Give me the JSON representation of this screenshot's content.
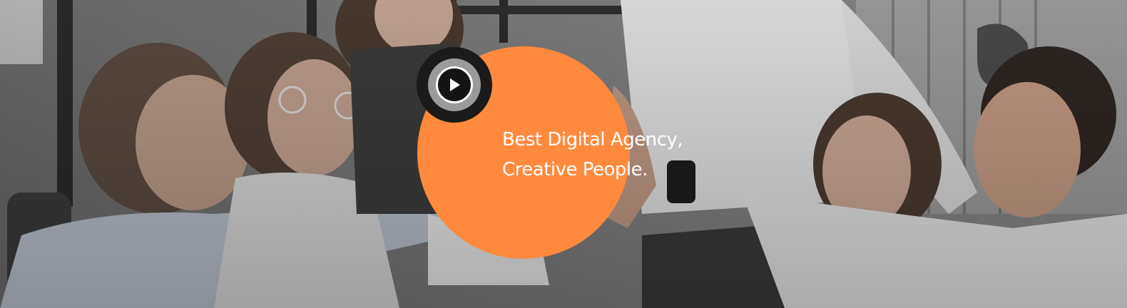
{
  "hero": {
    "headline_line1": "Best Digital Agency,",
    "headline_line2": "Creative People."
  },
  "icons": {
    "play": "play-icon"
  },
  "colors": {
    "accent": "#ff8a3d",
    "play_outer": "#1b1b1b",
    "play_ring": "#9a9a9a",
    "text": "#ffffff"
  }
}
